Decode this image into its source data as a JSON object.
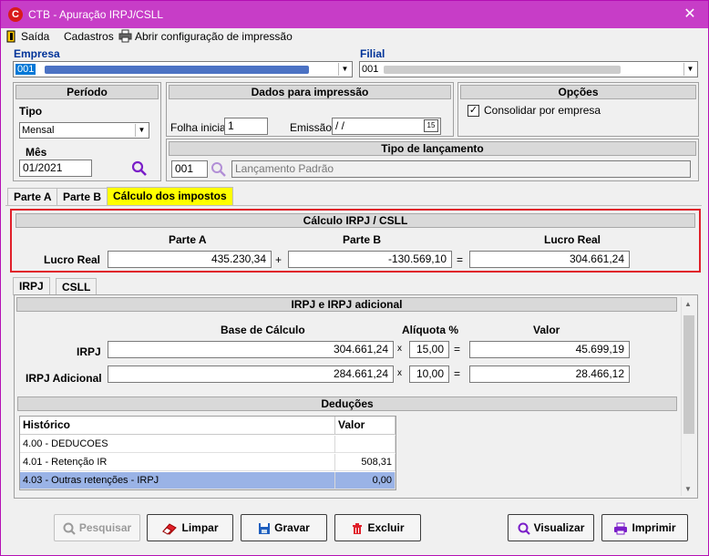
{
  "window": {
    "title": "CTB - Apuração IRPJ/CSLL",
    "close_glyph": "✕",
    "icon_letter": "C"
  },
  "menu": {
    "saida": "Saída",
    "cadastros": "Cadastros",
    "print_config": "Abrir configuração de impressão"
  },
  "empresa": {
    "label": "Empresa",
    "code": "001"
  },
  "filial": {
    "label": "Filial",
    "code": "001"
  },
  "periodo": {
    "title": "Período",
    "tipo_label": "Tipo",
    "tipo_value": "Mensal",
    "mes_label": "Mês",
    "mes_value": "01/2021"
  },
  "dados_impressao": {
    "title": "Dados para impressão",
    "folha_label": "Folha inicial",
    "folha_value": "1",
    "emissao_label": "Emissão",
    "emissao_value": " / /",
    "calendar_glyph": "15"
  },
  "opcoes": {
    "title": "Opções",
    "consolidar_label": "Consolidar por empresa",
    "consolidar_checked": true
  },
  "tipo_lancamento": {
    "title": "Tipo de lançamento",
    "code": "001",
    "description": "Lançamento Padrão"
  },
  "tabs": {
    "parte_a": "Parte A",
    "parte_b": "Parte B",
    "calculo": "Cálculo dos impostos"
  },
  "calculo": {
    "title": "Cálculo IRPJ / CSLL",
    "col_parte_a": "Parte A",
    "col_parte_b": "Parte B",
    "col_lucro": "Lucro Real",
    "row_label": "Lucro Real",
    "parte_a_value": "435.230,34",
    "plus": "+",
    "parte_b_value": "-130.569,10",
    "equals": "=",
    "lucro_value": "304.661,24"
  },
  "subtabs": {
    "irpj": "IRPJ",
    "csll": "CSLL"
  },
  "irpj": {
    "title": "IRPJ e IRPJ adicional",
    "col_base": "Base de Cálculo",
    "col_aliquota": "Alíquota %",
    "col_valor": "Valor",
    "rows": [
      {
        "label": "IRPJ",
        "base": "304.661,24",
        "times": "x",
        "aliquota": "15,00",
        "equals": "=",
        "valor": "45.699,19"
      },
      {
        "label": "IRPJ Adicional",
        "base": "284.661,24",
        "times": "x",
        "aliquota": "10,00",
        "equals": "=",
        "valor": "28.466,12"
      }
    ]
  },
  "deducoes": {
    "title": "Deduções",
    "columns": [
      "Histórico",
      "Valor"
    ],
    "rows": [
      {
        "historico": "4.00 - DEDUCOES",
        "valor": ""
      },
      {
        "historico": "4.01 - Retenção IR",
        "valor": "508,31"
      },
      {
        "historico": "4.03 - Outras retenções - IRPJ",
        "valor": "0,00"
      }
    ]
  },
  "buttons": {
    "pesquisar": "Pesquisar",
    "limpar": "Limpar",
    "gravar": "Gravar",
    "excluir": "Excluir",
    "visualizar": "Visualizar",
    "imprimir": "Imprimir"
  },
  "colors": {
    "title_bar": "#c73dc7",
    "tab_highlight": "#ffff00",
    "highlight_frame": "#e0202a",
    "selected_row": "#9ab3e6"
  }
}
